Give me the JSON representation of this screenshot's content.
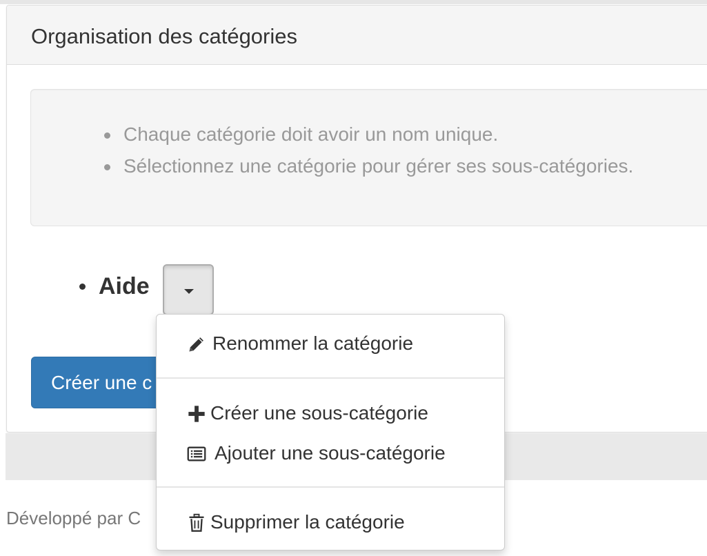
{
  "panel": {
    "title": "Organisation des catégories"
  },
  "tips": [
    "Chaque catégorie doit avoir un nom unique.",
    "Sélectionnez une catégorie pour gérer ses sous-catégories."
  ],
  "category": {
    "name": "Aide"
  },
  "dropdown": {
    "rename": "Renommer la catégorie",
    "create_sub": "Créer une sous-catégorie",
    "add_sub": "Ajouter une sous-catégorie",
    "delete": "Supprimer la catégorie"
  },
  "actions": {
    "create_category": "Créer une c"
  },
  "footer": {
    "text": "Développé par C"
  },
  "colors": {
    "primary": "#337ab7",
    "panel_heading": "#f5f5f5",
    "well": "#f5f5f5",
    "muted_text": "#999999"
  },
  "icons": {
    "rename": "pencil-icon",
    "create_sub": "plus-icon",
    "add_sub": "list-alt-icon",
    "delete": "trash-icon",
    "toggle": "caret-down-icon"
  }
}
